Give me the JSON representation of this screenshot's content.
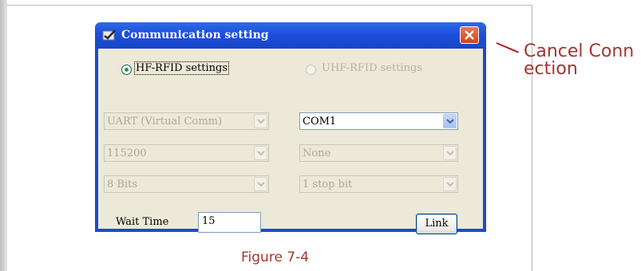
{
  "dialog": {
    "title": "Communication setting",
    "colors": {
      "titlebar": "#1d4bc9",
      "client": "#ece9d8",
      "close": "#d2431f"
    }
  },
  "radios": {
    "hf_label": "HF-RFID settings",
    "hf_selected": true,
    "uhf_label": "UHF-RFID settings",
    "uhf_enabled": false
  },
  "left_combos": {
    "interface": "UART (Virtual Comm)",
    "baud": "115200",
    "data_bits": "8 Bits"
  },
  "right_combos": {
    "port": "COM1",
    "parity": "None",
    "stop_bits": "1 stop bit"
  },
  "wait": {
    "label": "Wait Time",
    "value": "15"
  },
  "link_label": "Link",
  "caption": "Figure 7-4",
  "annotation": "Cancel Connection"
}
